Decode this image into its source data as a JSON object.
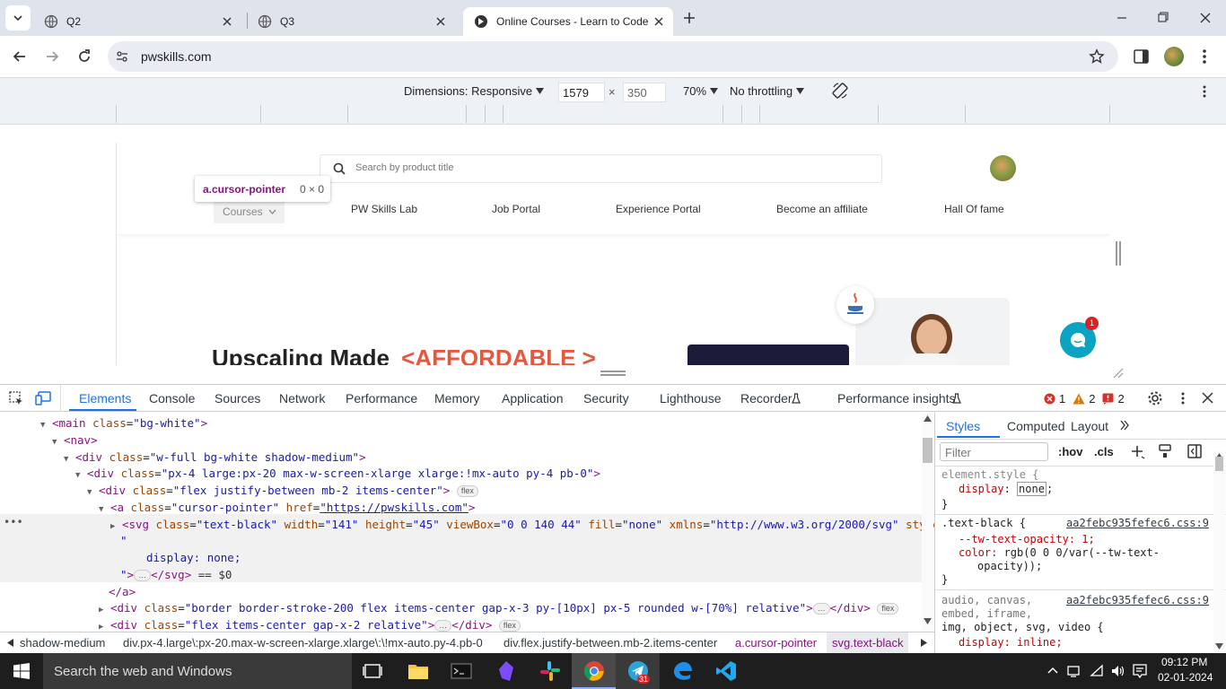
{
  "tabs": [
    {
      "title": "Q2"
    },
    {
      "title": "Q3"
    },
    {
      "title": "Online Courses - Learn to Code"
    }
  ],
  "address": {
    "url": "pwskills.com"
  },
  "device_toolbar": {
    "dimensions_label": "Dimensions: Responsive",
    "width": "1579",
    "times": "×",
    "height": "350",
    "zoom": "70%",
    "throttling": "No throttling"
  },
  "page": {
    "search_placeholder": "Search by product title",
    "tooltip_selector": "a.cursor-pointer",
    "tooltip_size": "0 × 0",
    "nav": [
      "Courses",
      "PW Skills Lab",
      "Job Portal",
      "Experience Portal",
      "Become an affiliate",
      "Hall Of fame"
    ],
    "hero_text_1": "Upscaling Made",
    "hero_text_2": "<AFFORDABLE >",
    "chat_badge": "1"
  },
  "devtools": {
    "tabs": [
      "Elements",
      "Console",
      "Sources",
      "Network",
      "Performance",
      "Memory",
      "Application",
      "Security",
      "Lighthouse",
      "Recorder",
      "Performance insights"
    ],
    "errors": "1",
    "warnings": "2",
    "issues": "2",
    "dom_lines": [
      {
        "ind": 48,
        "tri": "▼",
        "html": "<span class=\"tg\">&lt;main</span> <span class=\"an\">class</span>=<span class=\"av\">\"bg-white\"</span><span class=\"tg\">&gt;</span>"
      },
      {
        "ind": 61,
        "tri": "▼",
        "html": "<span class=\"tg\">&lt;nav&gt;</span>"
      },
      {
        "ind": 74,
        "tri": "▼",
        "html": "<span class=\"tg\">&lt;div</span> <span class=\"an\">class</span>=<span class=\"av\">\"w-full bg-white shadow-medium\"</span><span class=\"tg\">&gt;</span>"
      },
      {
        "ind": 87,
        "tri": "▼",
        "html": "<span class=\"tg\">&lt;div</span> <span class=\"an\">class</span>=<span class=\"av\">\"px-4 large:px-20 max-w-screen-xlarge xlarge:!mx-auto py-4 pb-0\"</span><span class=\"tg\">&gt;</span>"
      },
      {
        "ind": 100,
        "tri": "▼",
        "html": "<span class=\"tg\">&lt;div</span> <span class=\"an\">class</span>=<span class=\"av\">\"flex justify-between mb-2 items-center\"</span><span class=\"tg\">&gt;</span> <span class=\"pill\">flex</span>"
      },
      {
        "ind": 113,
        "tri": "▼",
        "html": "<span class=\"tg\">&lt;a</span> <span class=\"an\">class</span>=<span class=\"av\">\"cursor-pointer\"</span> <span class=\"an\">href</span>=<span class=\"av\" style=\"text-decoration:underline\">\"https://pwskills.com\"</span><span class=\"tg\">&gt;</span>"
      },
      {
        "ind": 126,
        "tri": "▶",
        "html": "<span class=\"tg\">&lt;svg</span> <span class=\"an\">class</span>=<span class=\"av\">\"text-black\"</span> <span class=\"an\">width</span>=<span class=\"av\">\"141\"</span> <span class=\"an\">height</span>=<span class=\"av\">\"45\"</span> <span class=\"an\">viewBox</span>=<span class=\"av\">\"0 0 140 44\"</span> <span class=\"an\">fill</span>=<span class=\"av\">\"none\"</span> <span class=\"an\">xmlns</span>=<span class=\"av\">\"http://www.w3.org/2000/svg\"</span> <span class=\"an\">style</span>=<span class=\"av\">\"</span>"
      },
      {
        "ind": 134,
        "tri": "",
        "html": "<span class=\"av\">\"</span>"
      },
      {
        "ind": 163,
        "tri": "",
        "html": "<span class=\"av\">display: none;</span>"
      },
      {
        "ind": 134,
        "tri": "",
        "html": "<span class=\"av\">\"</span><span class=\"tg\">&gt;</span><span class=\"pill\">…</span><span class=\"tg\">&lt;/svg&gt;</span> <span class=\"cm\">== $0</span>"
      },
      {
        "ind": 121,
        "tri": "",
        "html": "<span class=\"tg\">&lt;/a&gt;</span>"
      },
      {
        "ind": 113,
        "tri": "▶",
        "html": "<span class=\"tg\">&lt;div</span> <span class=\"an\">class</span>=<span class=\"av\">\"border border-stroke-200 flex items-center gap-x-3 py-[10px] px-5 rounded w-[70%] relative\"</span><span class=\"tg\">&gt;</span><span class=\"pill\">…</span><span class=\"tg\">&lt;/div&gt;</span> <span class=\"pill\">flex</span>"
      },
      {
        "ind": 113,
        "tri": "▶",
        "html": "<span class=\"tg\">&lt;div</span> <span class=\"an\">class</span>=<span class=\"av\">\"flex items-center gap-x-2 relative\"</span><span class=\"tg\">&gt;</span><span class=\"pill\">…</span><span class=\"tg\">&lt;/div&gt;</span> <span class=\"pill\">flex</span>"
      }
    ],
    "styles_tabs": [
      "Styles",
      "Computed",
      "Layout"
    ],
    "filter_placeholder": "Filter",
    "hov": ":hov",
    "cls": ".cls",
    "rule1_sel": "element.style {",
    "rule1_prop": "display",
    "rule1_val": "none",
    "rule2_sel": ".text-black {",
    "rule2_src": "aa2febc935fefec6.css:9",
    "rule2_p1": "--tw-text-opacity: 1;",
    "rule2_p2a": "color: ",
    "rule2_p2b": "rgb(0 0 0/var(--tw-text-",
    "rule2_p2c": "opacity));",
    "rule3_sel": "audio, canvas,",
    "rule3_sel2": "embed, iframe,",
    "rule3_sel3": "img, object, svg, video {",
    "rule3_src": "aa2febc935fefec6.css:9",
    "rule3_p1": "display: inline;",
    "close": "}",
    "breadcrumbs": [
      "shadow-medium",
      "div.px-4.large\\:px-20.max-w-screen-xlarge.xlarge\\:\\!mx-auto.py-4.pb-0",
      "div.flex.justify-between.mb-2.items-center",
      "a.cursor-pointer",
      "svg.text-black"
    ]
  },
  "taskbar": {
    "search_placeholder": "Search the web and Windows",
    "time": "09:12 PM",
    "date": "02-01-2024",
    "edge_badge": "31"
  },
  "colors": {
    "accent": "#1a73e8",
    "affordable": "#e8563e",
    "chat": "#0aa3c2"
  }
}
